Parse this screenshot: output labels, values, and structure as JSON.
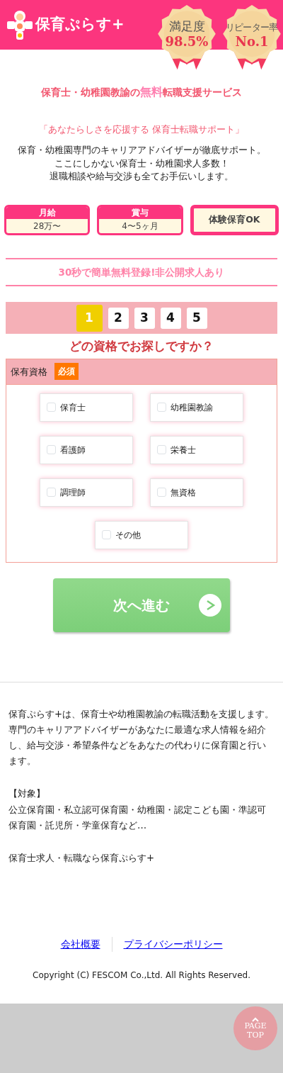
{
  "header": {
    "logo_text": "保育ぷらす+",
    "badges": [
      {
        "label": "満足度",
        "value": "98.5%"
      },
      {
        "label": "リピーター率",
        "value": "No.1"
      }
    ]
  },
  "headline": {
    "before": "保育士・幼稚園教諭の",
    "highlight": "無料",
    "after": "転職支援サービス"
  },
  "tagline": "「あなたらしさを応援する 保育士転職サポート」",
  "intro": [
    "保育・幼稚園専門のキャリアアドバイザーが徹底サポート。",
    "ここにしかない保育士・幼稚園求人多数！",
    "退職相談や給与交渉も全てお手伝いします。"
  ],
  "benefits": [
    {
      "kind": "split",
      "label": "月給",
      "value": "28万〜"
    },
    {
      "kind": "split",
      "label": "賞与",
      "value": "4〜5ヶ月"
    },
    {
      "kind": "single",
      "value": "体験保育OK"
    }
  ],
  "register_banner": "30秒で簡単無料登録!非公開求人あり",
  "steps": [
    {
      "label": "1",
      "selected": true
    },
    {
      "label": "2",
      "selected": false
    },
    {
      "label": "3",
      "selected": false
    },
    {
      "label": "4",
      "selected": false
    },
    {
      "label": "5",
      "selected": false
    }
  ],
  "question": "どの資格でお探しですか？",
  "form": {
    "label": "保有資格",
    "required_badge": "必須",
    "options": [
      {
        "label": "保育士",
        "checked": false
      },
      {
        "label": "幼稚園教諭",
        "checked": false
      },
      {
        "label": "看護師",
        "checked": false
      },
      {
        "label": "栄養士",
        "checked": false
      },
      {
        "label": "調理師",
        "checked": false
      },
      {
        "label": "無資格",
        "checked": false
      },
      {
        "label": "その他",
        "checked": false
      }
    ]
  },
  "next_button": "次へ進む",
  "about": [
    "保育ぷらす+は、保育士や幼稚園教諭の転職活動を支援します。",
    "専門のキャリアアドバイザーがあなたに最適な求人情報を紹介し、給与交渉・希望条件などをあなたの代わりに保育園と行います。",
    "【対象】",
    "公立保育園・私立認可保育園・幼稚園・認定こども園・準認可保育園・託児所・学童保育など…",
    "保育士求人・転職なら保育ぷらす+"
  ],
  "footer": {
    "links": [
      "会社概要",
      "プライバシーポリシー"
    ],
    "copyright": "Copyright (C) FESCOM Co.,Ltd. All Rights Reserved."
  },
  "page_top": {
    "label": "PAGE TOP"
  }
}
